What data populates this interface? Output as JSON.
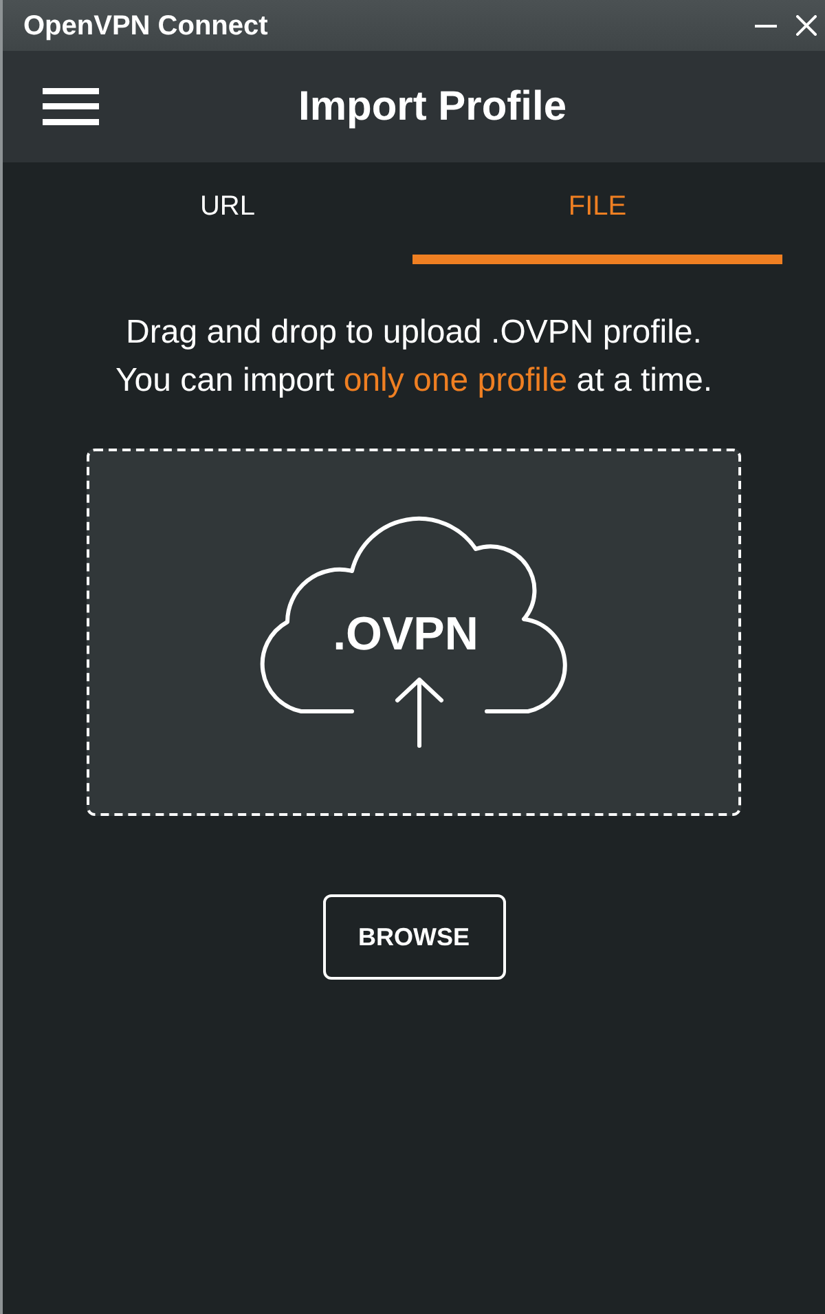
{
  "window": {
    "title": "OpenVPN Connect"
  },
  "header": {
    "title": "Import Profile"
  },
  "tabs": [
    {
      "label": "URL",
      "selected": false
    },
    {
      "label": "FILE",
      "selected": true
    }
  ],
  "instructions": {
    "lines": [
      [
        {
          "text": "Drag and drop to upload .OVPN profile.",
          "highlight": false
        }
      ],
      [
        {
          "text": "You can import ",
          "highlight": false
        },
        {
          "text": "only one profile",
          "highlight": true
        },
        {
          "text": " at a time.",
          "highlight": false
        }
      ]
    ]
  },
  "drop_zone": {
    "file_type": ".OVPN"
  },
  "browse_button": {
    "label": "BROWSE"
  }
}
